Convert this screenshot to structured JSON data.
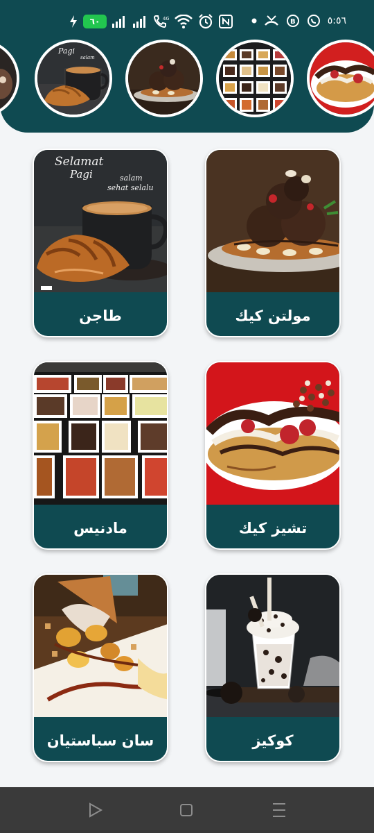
{
  "status_bar": {
    "battery": "٦٠",
    "time": "٥:٥٦",
    "icons": [
      "charging-icon",
      "signal-icon",
      "signal-icon",
      "volte-icon",
      "wifi-icon",
      "alarm-icon",
      "nfc-icon",
      "dot-icon",
      "missed-call-icon",
      "whatsapp-business-icon",
      "whatsapp-icon"
    ]
  },
  "stories": [
    {
      "name": "story-partial"
    },
    {
      "name": "story-coffee"
    },
    {
      "name": "story-molten"
    },
    {
      "name": "story-waffles"
    },
    {
      "name": "story-cheesecake"
    }
  ],
  "photo_text": {
    "selamat": "Selamat",
    "pagi": "Pagi",
    "salam": "salam",
    "sehat": "sehat selalu"
  },
  "cards": [
    {
      "label": "طاجن",
      "photo": "coffee-croissant"
    },
    {
      "label": "مولتن كيك",
      "photo": "molten-cake"
    },
    {
      "label": "مادنيس",
      "photo": "waffle-tray"
    },
    {
      "label": "تشيز كيك",
      "photo": "cheesecake-waffle"
    },
    {
      "label": "سان سباستيان",
      "photo": "banana-dessert"
    },
    {
      "label": "كوكيز",
      "photo": "cookies-shake"
    }
  ],
  "nav_bar": {
    "buttons": [
      "back-icon",
      "home-icon",
      "recents-icon"
    ]
  }
}
